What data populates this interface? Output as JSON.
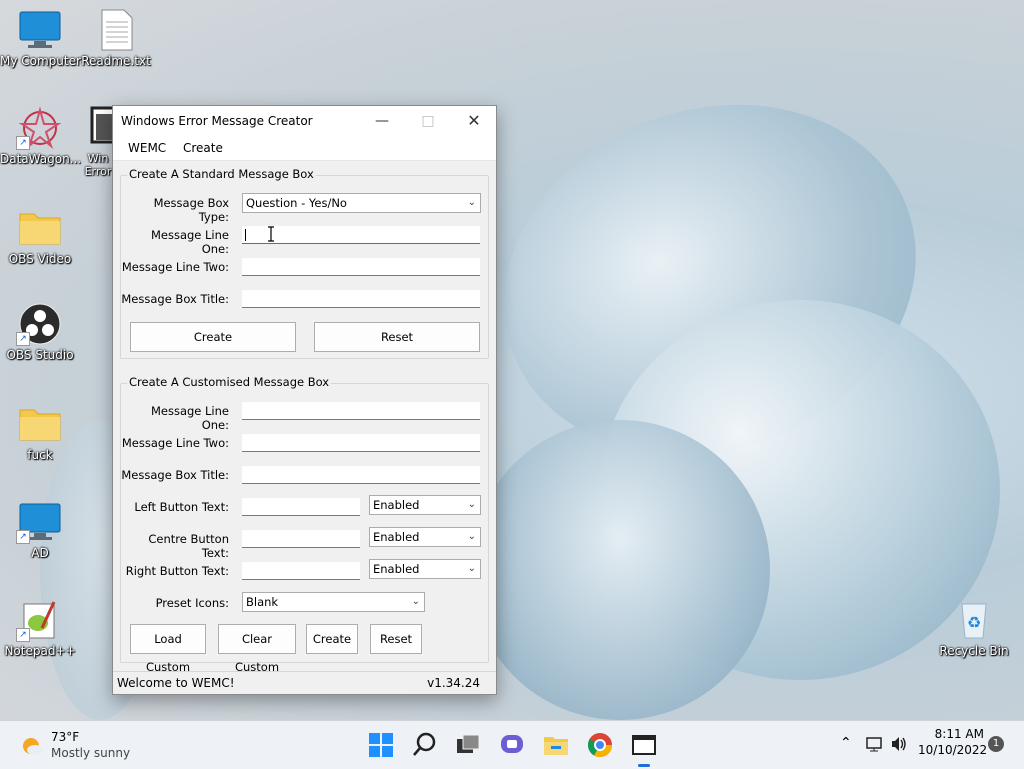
{
  "desktop": {
    "icons": [
      {
        "label": "My Computer",
        "icon": "computer-icon"
      },
      {
        "label": "Readme.txt",
        "icon": "text-file-icon"
      },
      {
        "label": "DataWagon...",
        "icon": "app-icon"
      },
      {
        "label": "Win Error",
        "icon": "window-icon"
      },
      {
        "label": "OBS Video",
        "icon": "folder-icon"
      },
      {
        "label": "OBS Studio",
        "icon": "obs-icon"
      },
      {
        "label": "fuck",
        "icon": "folder-icon"
      },
      {
        "label": "AD",
        "icon": "computer-icon"
      },
      {
        "label": "Notepad++",
        "icon": "notepadpp-icon"
      },
      {
        "label": "Recycle Bin",
        "icon": "recycle-bin-icon"
      }
    ]
  },
  "window": {
    "title": "Windows Error Message Creator",
    "menu": [
      "WEMC",
      "Create"
    ],
    "standard": {
      "legend": "Create A Standard Message Box",
      "type_label": "Message Box Type:",
      "type_value": "Question - Yes/No",
      "line1_label": "Message Line One:",
      "line1_value": "",
      "line2_label": "Message Line Two:",
      "line2_value": "",
      "title_label": "Message Box Title:",
      "title_value": "",
      "create_label": "Create",
      "reset_label": "Reset"
    },
    "custom": {
      "legend": "Create A Customised Message Box",
      "line1_label": "Message Line One:",
      "line2_label": "Message Line Two:",
      "title_label": "Message Box Title:",
      "left_label": "Left Button Text:",
      "left_state": "Enabled",
      "centre_label": "Centre Button Text:",
      "centre_state": "Enabled",
      "right_label": "Right Button Text:",
      "right_state": "Enabled",
      "preset_label": "Preset Icons:",
      "preset_value": "Blank",
      "load_label": "Load Custom",
      "clear_label": "Clear Custom",
      "create_label": "Create",
      "reset_label": "Reset"
    },
    "status": {
      "message": "Welcome to WEMC!",
      "version": "v1.34.24"
    }
  },
  "taskbar": {
    "weather_temp": "73°F",
    "weather_desc": "Mostly sunny",
    "time": "8:11 AM",
    "date": "10/10/2022",
    "notifications": "1"
  }
}
